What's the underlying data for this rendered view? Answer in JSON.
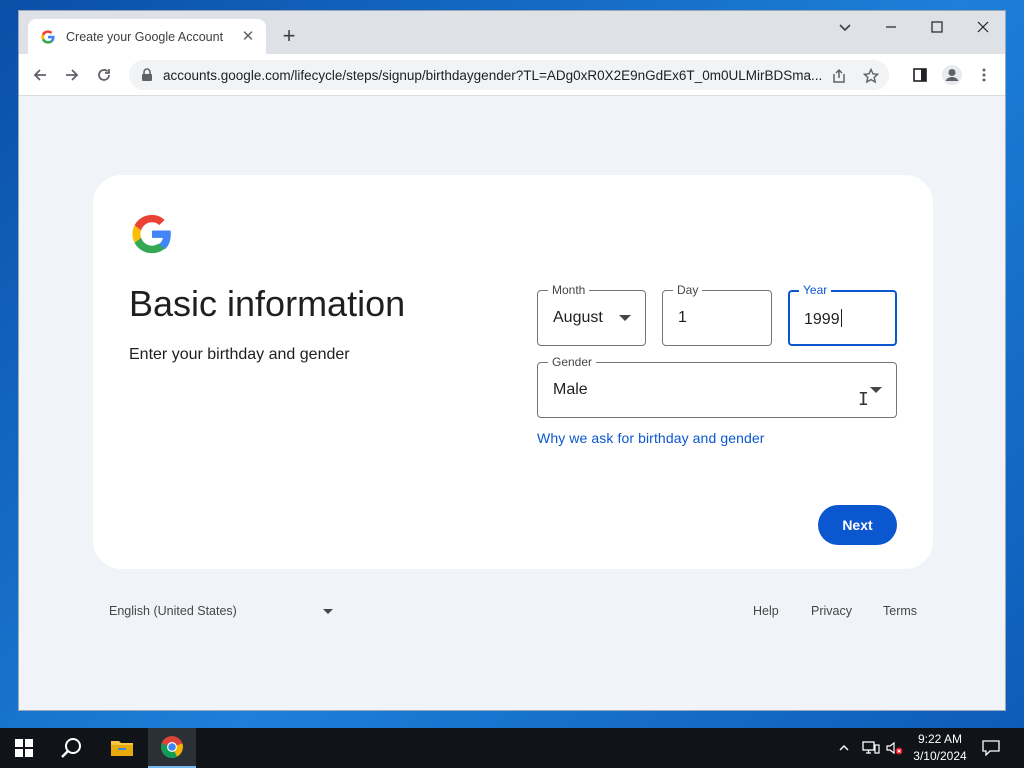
{
  "browser": {
    "tab_title": "Create your Google Account",
    "url": "accounts.google.com/lifecycle/steps/signup/birthdaygender?TL=ADg0xR0X2E9nGdEx6T_0m0ULMirBDSma..."
  },
  "page": {
    "heading": "Basic information",
    "subheading": "Enter your birthday and gender",
    "month": {
      "label": "Month",
      "value": "August"
    },
    "day": {
      "label": "Day",
      "value": "1"
    },
    "year": {
      "label": "Year",
      "value": "1999"
    },
    "gender": {
      "label": "Gender",
      "value": "Male"
    },
    "why_link": "Why we ask for birthday and gender",
    "next_label": "Next"
  },
  "footer": {
    "language": "English (United States)",
    "help": "Help",
    "privacy": "Privacy",
    "terms": "Terms"
  },
  "taskbar": {
    "time": "9:22 AM",
    "date": "3/10/2024"
  },
  "colors": {
    "accent": "#0b57d0",
    "page_bg": "#f0f4f9"
  }
}
